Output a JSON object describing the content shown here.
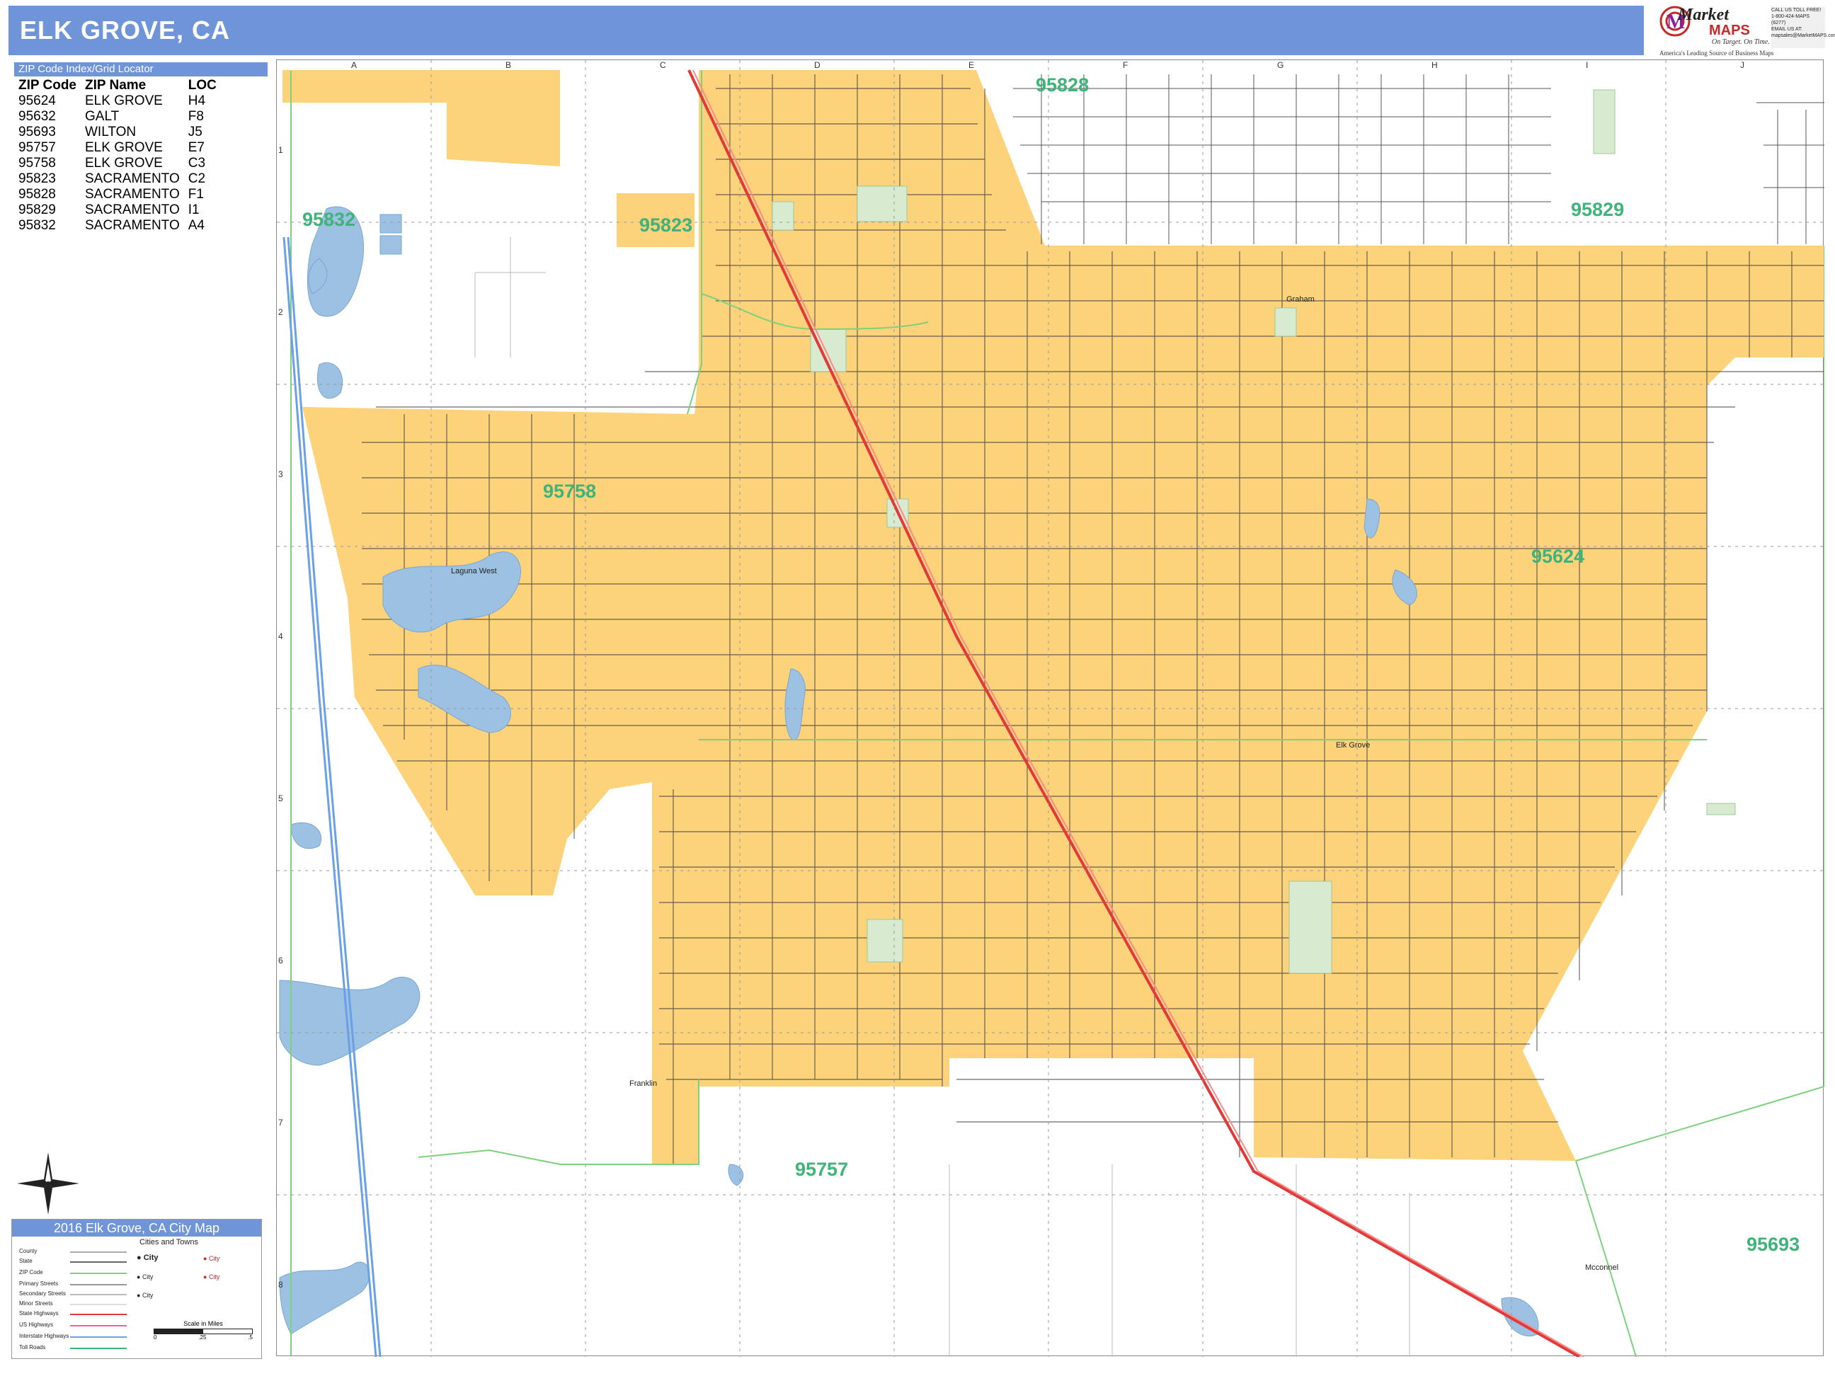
{
  "title": "ELK GROVE, CA",
  "logo": {
    "brand_top": "Market",
    "brand_bottom": "MAPS",
    "slogan": "On Target. On Time.",
    "tagline": "America's Leading Source of Business Maps",
    "contact_lines": [
      "CALL US TOLL FREE!",
      "1-800-424-MAPS (6277)",
      "",
      "EMAIL US AT:",
      "mapsales@MarketMAPS.com"
    ]
  },
  "zip_index": {
    "header": "ZIP Code Index/Grid Locator",
    "columns": [
      "ZIP Code",
      "ZIP Name",
      "LOC"
    ],
    "rows": [
      [
        "95624",
        "ELK GROVE",
        "H4"
      ],
      [
        "95632",
        "GALT",
        "F8"
      ],
      [
        "95693",
        "WILTON",
        "J5"
      ],
      [
        "95757",
        "ELK GROVE",
        "E7"
      ],
      [
        "95758",
        "ELK GROVE",
        "C3"
      ],
      [
        "95823",
        "SACRAMENTO",
        "C2"
      ],
      [
        "95828",
        "SACRAMENTO",
        "F1"
      ],
      [
        "95829",
        "SACRAMENTO",
        "I1"
      ],
      [
        "95832",
        "SACRAMENTO",
        "A4"
      ]
    ]
  },
  "grid": {
    "letters": [
      "A",
      "B",
      "C",
      "D",
      "E",
      "F",
      "G",
      "H",
      "I",
      "J"
    ],
    "numbers": [
      "1",
      "2",
      "3",
      "4",
      "5",
      "6",
      "7",
      "8"
    ]
  },
  "zip_labels": {
    "z95828": "95828",
    "z95832": "95832",
    "z95823": "95823",
    "z95829": "95829",
    "z95758": "95758",
    "z95624": "95624",
    "z95757": "95757",
    "z95693": "95693"
  },
  "places": {
    "laguna_west": "Laguna West",
    "elk_grove": "Elk Grove",
    "graham": "Graham",
    "franklin": "Franklin",
    "mcconnel": "Mcconnel"
  },
  "legend": {
    "title": "2016 Elk Grove, CA City Map",
    "rows": [
      "County",
      "State",
      "ZIP Code",
      "Primary Streets",
      "Secondary Streets",
      "Minor Streets",
      "State Highways",
      "US Highways",
      "Interstate Highways",
      "Toll Roads"
    ],
    "cities_title": "Cities and Towns",
    "city_word": "City",
    "scale_title": "Scale in Miles",
    "scale_ticks": [
      "0",
      ".25",
      ".5"
    ]
  },
  "colors": {
    "city_fill": "#fcd37a",
    "water": "#9cc1e3",
    "park": "#d8ead0",
    "zip_label": "#3fb37a",
    "header": "#6f95d8",
    "highway": "#e03a3a",
    "zip_boundary": "#7ed07e"
  }
}
